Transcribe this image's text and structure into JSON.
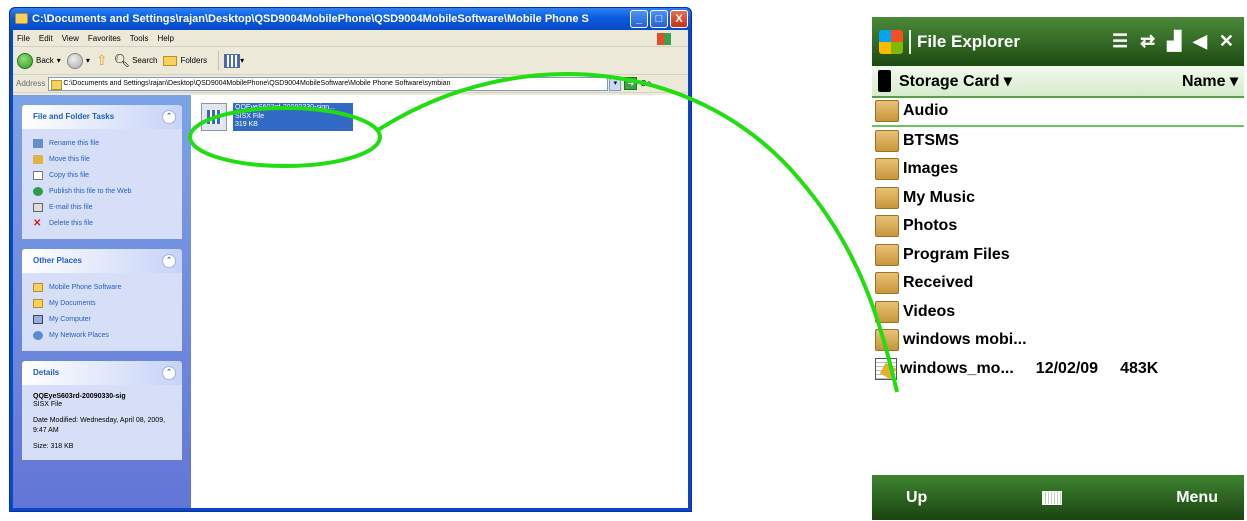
{
  "xp_window": {
    "title": "C:\\Documents and Settings\\rajan\\Desktop\\QSD9004MobilePhone\\QSD9004MobileSoftware\\Mobile Phone S",
    "controls": {
      "minimize": "_",
      "maximize": "□",
      "close": "X"
    },
    "menu": [
      "File",
      "Edit",
      "View",
      "Favorites",
      "Tools",
      "Help"
    ],
    "toolbar": {
      "back": "Back",
      "search": "Search",
      "folders": "Folders"
    },
    "address_label": "Address",
    "address_value": "C:\\Documents and Settings\\rajan\\Desktop\\QSD9004MobilePhone\\QSD9004MobileSoftware\\Mobile Phone Software\\symbian",
    "go_label": "Go",
    "file_tasks": {
      "title": "File and Folder Tasks",
      "items": [
        "Rename this file",
        "Move this file",
        "Copy this file",
        "Publish this file to the Web",
        "E-mail this file",
        "Delete this file"
      ]
    },
    "other_places": {
      "title": "Other Places",
      "items": [
        "Mobile Phone Software",
        "My Documents",
        "My Computer",
        "My Network Places"
      ]
    },
    "details": {
      "title": "Details",
      "name": "QQEyeS603rd-20090330-sig",
      "type": "SISX File",
      "date_modified": "Date Modified: Wednesday, April 08, 2009, 9:47 AM",
      "size": "Size: 318 KB"
    },
    "file": {
      "name": "QQEyeS603rd-20090330-sign...",
      "type": "SISX File",
      "size": "319 KB"
    }
  },
  "phone": {
    "title": "File Explorer",
    "location": "Storage Card",
    "sort": "Name",
    "folders": [
      "Audio",
      "BTSMS",
      "Images",
      "My Music",
      "Photos",
      "Program Files",
      "Received",
      "Videos",
      "windows mobi..."
    ],
    "file": {
      "name": "windows_mo...",
      "date": "12/02/09",
      "size": "483K"
    },
    "softkeys": {
      "left": "Up",
      "right": "Menu"
    },
    "status_icons": [
      "menu-icon",
      "sync-icon",
      "signal-icon",
      "volume-icon",
      "close-icon"
    ]
  },
  "annotation_color": "#22dd11"
}
